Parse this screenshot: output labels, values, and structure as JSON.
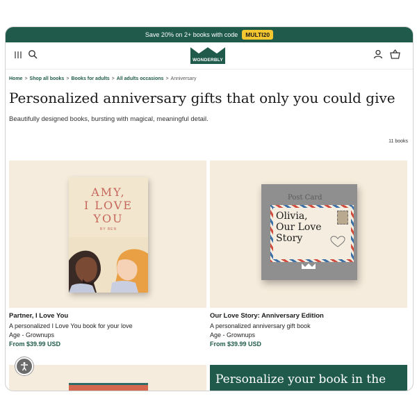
{
  "promo_bar": {
    "text": "Save 20% on 2+ books with code",
    "code": "MULTI20"
  },
  "header": {
    "logo_text": "WONDERBLY",
    "icons": [
      "menu-icon",
      "search-icon",
      "account-icon",
      "basket-icon"
    ]
  },
  "breadcrumb": [
    {
      "label": "Home",
      "link": true
    },
    {
      "label": "Shop all books",
      "link": true
    },
    {
      "label": "Books for adults",
      "link": true
    },
    {
      "label": "All adults occasions",
      "link": true
    },
    {
      "label": "Anniversary",
      "link": false
    }
  ],
  "page": {
    "title": "Personalized anniversary gifts that only you could give",
    "subtitle": "Beautifully designed books, bursting with magical, meaningful detail.",
    "count": "11 books"
  },
  "products": [
    {
      "title": "Partner, I Love You",
      "description": "A personalized I Love You book for your love",
      "age": "Age - Grownups",
      "price": "From $39.99 USD",
      "cover_title": "AMY,\nI LOVE\nYOU",
      "cover_by": "BY BEN"
    },
    {
      "title": "Our Love Story: Anniversary Edition",
      "description": "A personalized anniversary gift book",
      "age": "Age - Grownups",
      "price": "From $39.99 USD",
      "cover_label": "Post Card",
      "cover_title": "Olivia,\nOur Love\nStory"
    }
  ],
  "promo_panel": {
    "text": "Personalize your book in the"
  },
  "colors": {
    "brand": "#1f5a4a",
    "promo_code_bg": "#f4c630",
    "card_bg": "#f6ecdd"
  }
}
